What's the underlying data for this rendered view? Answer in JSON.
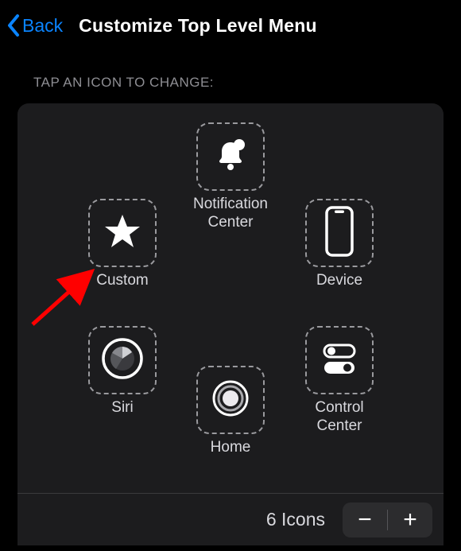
{
  "nav": {
    "back_label": "Back",
    "title": "Customize Top Level Menu"
  },
  "section_label": "TAP AN ICON TO CHANGE:",
  "items": {
    "notif": {
      "label": "Notification\nCenter",
      "icon": "bell-dot-icon"
    },
    "custom": {
      "label": "Custom",
      "icon": "star-icon"
    },
    "device": {
      "label": "Device",
      "icon": "phone-outline-icon"
    },
    "siri": {
      "label": "Siri",
      "icon": "siri-icon"
    },
    "control": {
      "label": "Control\nCenter",
      "icon": "toggles-icon"
    },
    "home": {
      "label": "Home",
      "icon": "home-ring-icon"
    }
  },
  "footer": {
    "count_label": "6 Icons",
    "minus": "−",
    "plus": "+"
  },
  "annotation": {
    "arrow_target": "custom",
    "color": "#ff0000"
  }
}
